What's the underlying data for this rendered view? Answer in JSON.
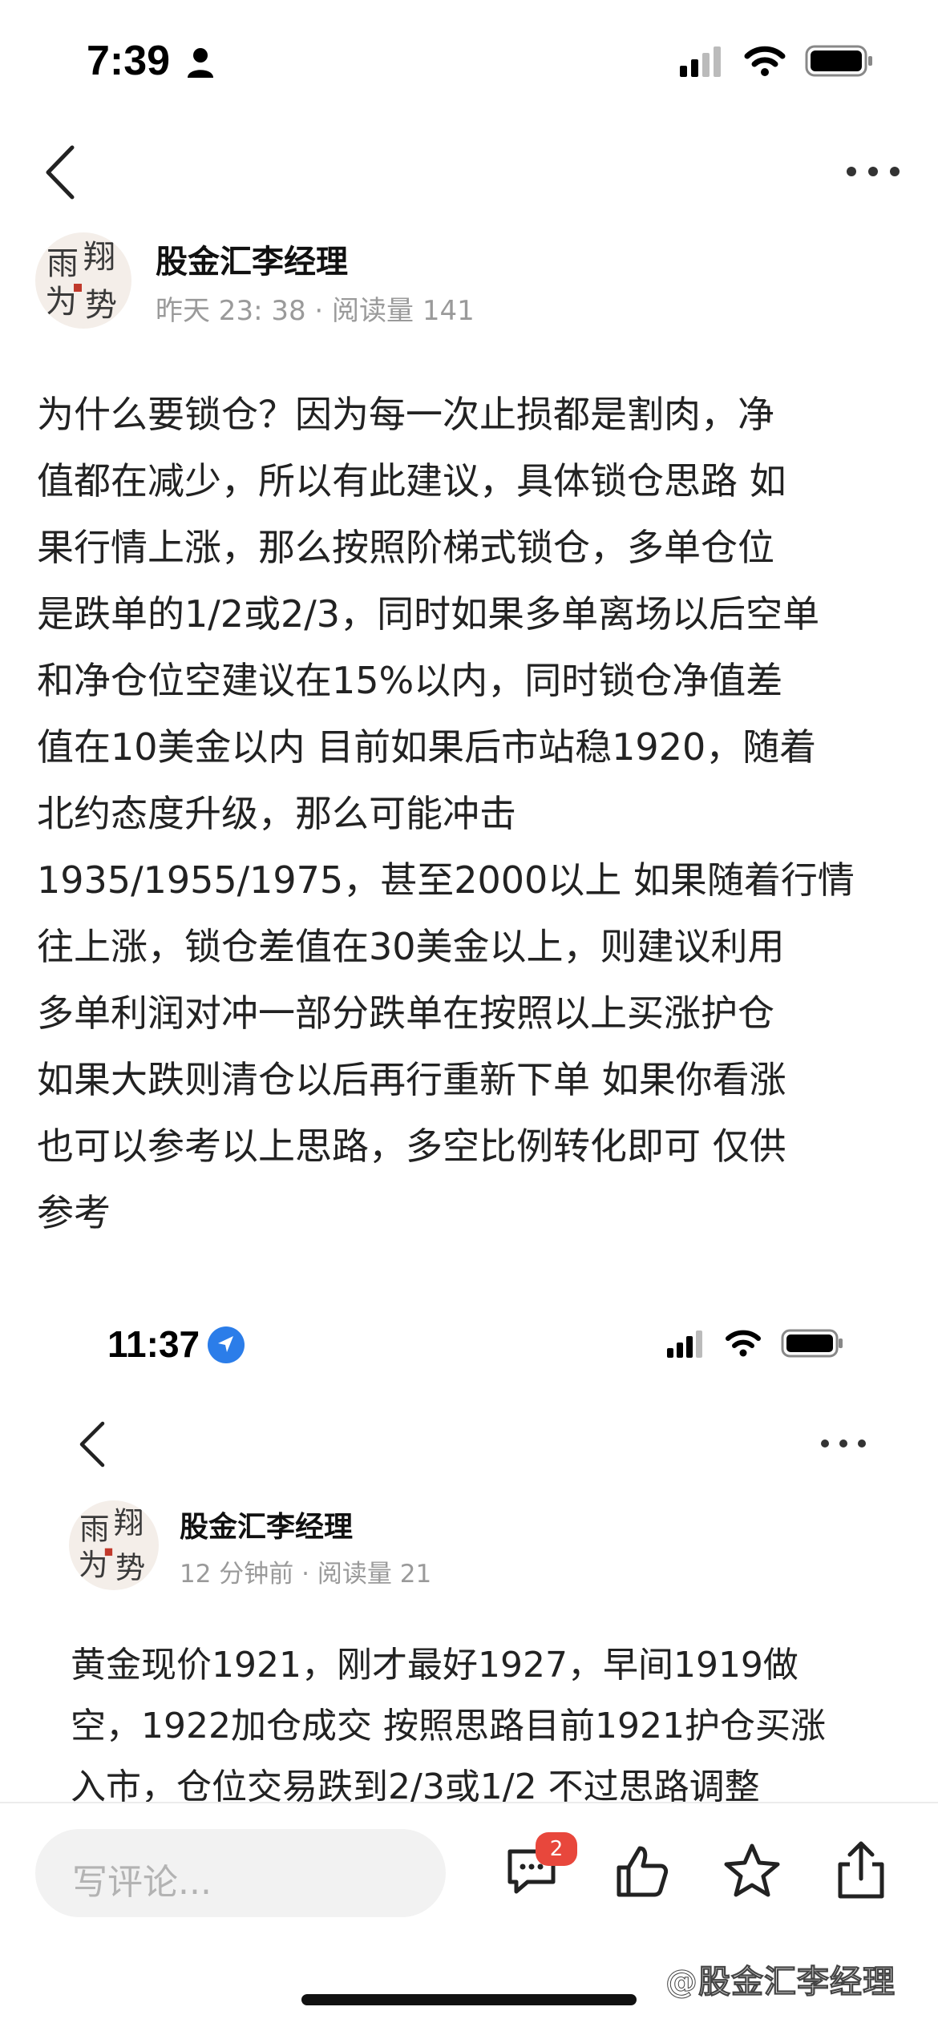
{
  "top_screen": {
    "status_time": "7:39",
    "author": "股金汇李经理",
    "meta": "昨天 23: 38 · 阅读量 141",
    "avatar_text": "雨 翔 为 势",
    "paragraph_lines": [
      "为什么要锁仓？因为每一次止损都是割肉，净",
      "值都在减少，所以有此建议，具体锁仓思路 如",
      "果行情上涨，那么按照阶梯式锁仓，多单仓位",
      "是跌单的1/2或2/3，同时如果多单离场以后空单",
      "和净仓位空建议在15%以内，同时锁仓净值差",
      "值在10美金以内 目前如果后市站稳1920，随着",
      "北约态度升级，那么可能冲击",
      "1935/1955/1975，甚至2000以上 如果随着行情",
      "往上涨，锁仓差值在30美金以上，则建议利用",
      "多单利润对冲一部分跌单在按照以上买涨护仓",
      "如果大跌则清仓以后再行重新下单 如果你看涨",
      "也可以参考以上思路，多空比例转化即可 仅供",
      "参考"
    ]
  },
  "bottom_screen": {
    "status_time": "11:37",
    "author": "股金汇李经理",
    "meta": "12 分钟前 · 阅读量 21",
    "paragraph_lines": [
      "黄金现价1921，刚才最好1927，早间1919做",
      "空，1922加仓成交 按照思路目前1921护仓买涨",
      "入市，仓位交易跌到2/3或1/2 不过思路调整"
    ]
  },
  "toolbar": {
    "comment_placeholder": "写评论...",
    "comment_count": "2"
  },
  "watermark": "@股金汇李经理",
  "icons": [
    "back-icon",
    "more-icon",
    "signal-icon",
    "wifi-icon",
    "battery-icon",
    "person-icon",
    "location-arrow-icon",
    "comment-icon",
    "like-icon",
    "star-icon",
    "share-icon"
  ]
}
